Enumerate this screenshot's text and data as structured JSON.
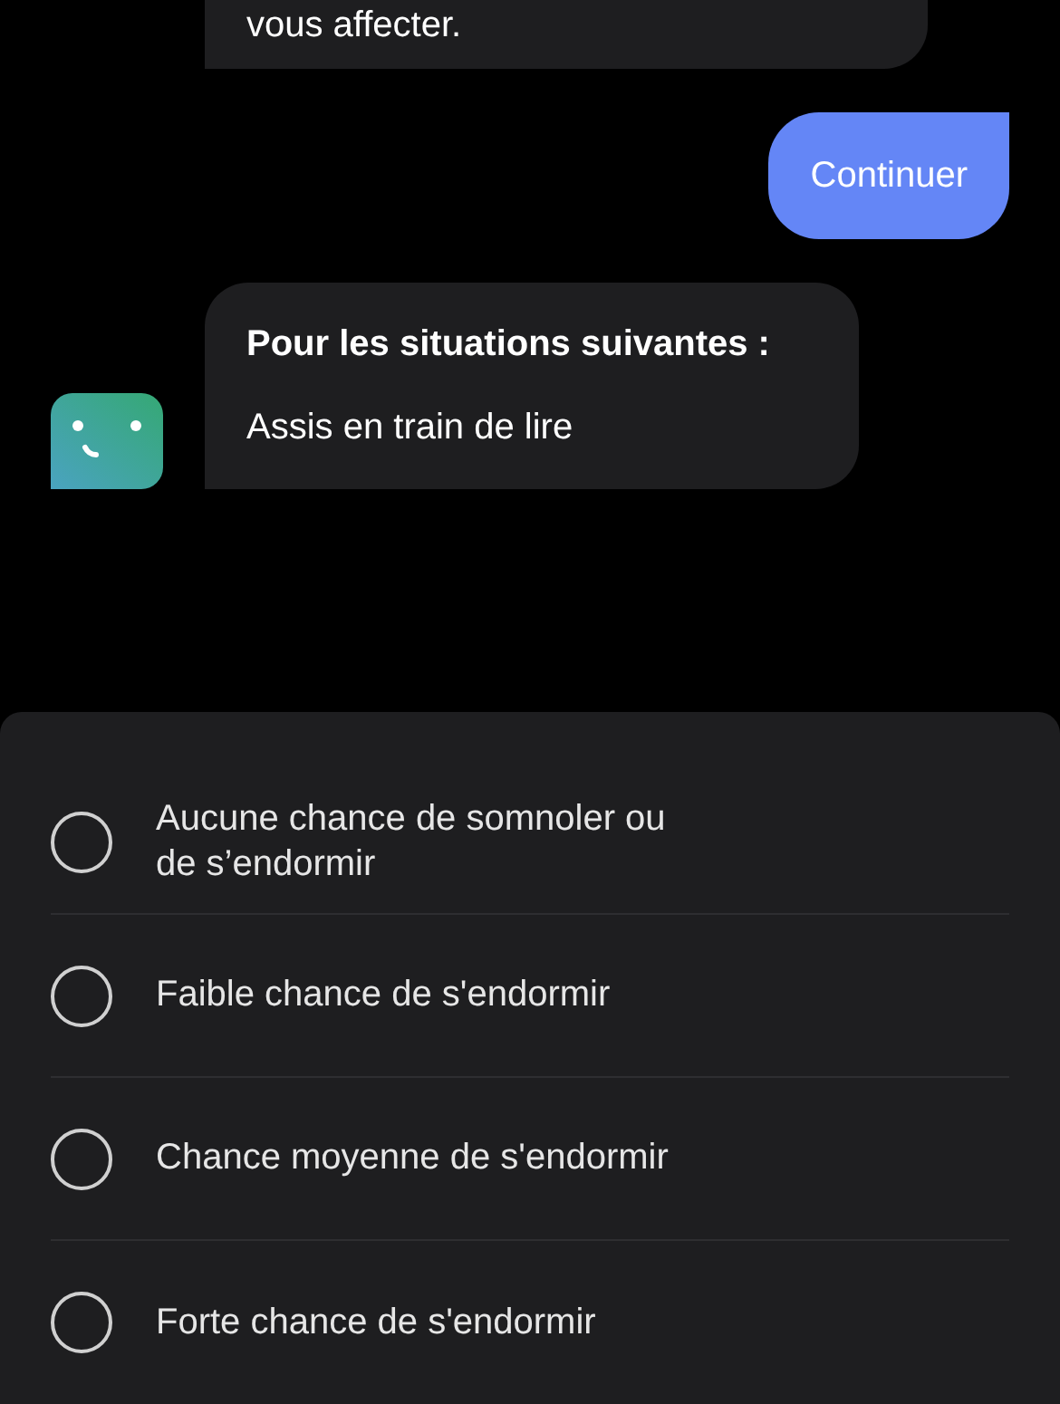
{
  "messages": [
    {
      "kind": "bot",
      "lines": [
        {
          "text": "vous affecter.",
          "bold": false
        }
      ]
    },
    {
      "kind": "user",
      "lines": [
        {
          "text": "Continuer",
          "bold": false
        }
      ]
    },
    {
      "kind": "bot",
      "avatar": true,
      "lines": [
        {
          "text": "Pour les situations suivantes :",
          "bold": true
        },
        {
          "text": "Assis en train de lire",
          "bold": false
        }
      ]
    }
  ],
  "options": [
    {
      "label": "Aucune chance de somnoler ou de s’endormir",
      "selected": false
    },
    {
      "label": "Faible chance de s'endormir",
      "selected": false
    },
    {
      "label": "Chance moyenne de s'endormir",
      "selected": false
    },
    {
      "label": "Forte chance de s'endormir",
      "selected": false
    }
  ]
}
